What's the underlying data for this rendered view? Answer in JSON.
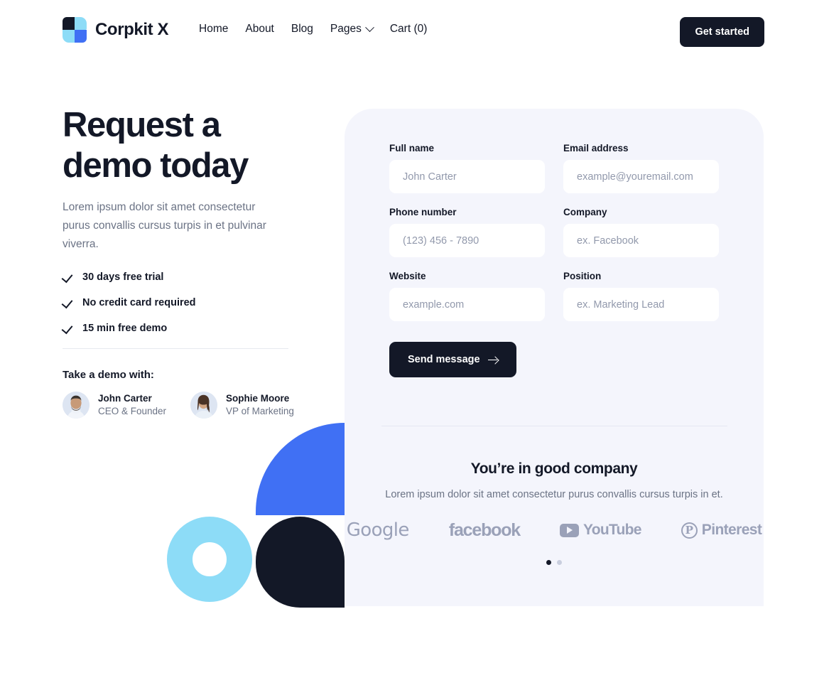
{
  "navbar": {
    "brand_name": "Corpkit X",
    "logo_colors": {
      "dark": "#131827",
      "light_blue": "#8ddcf7",
      "blue": "#4070f4"
    },
    "links": [
      {
        "label": "Home",
        "has_chevron": false
      },
      {
        "label": "About",
        "has_chevron": false
      },
      {
        "label": "Blog",
        "has_chevron": false
      },
      {
        "label": "Pages",
        "has_chevron": true
      },
      {
        "label": "Cart (0)",
        "has_chevron": false
      }
    ],
    "cta_label": "Get started"
  },
  "hero": {
    "title_line1": "Request a",
    "title_line2": "demo today",
    "subtitle": "Lorem ipsum dolor sit amet consectetur purus convallis cursus turpis in et pulvinar viverra.",
    "features": [
      {
        "label": "30 days free trial"
      },
      {
        "label": "No credit card required"
      },
      {
        "label": "15 min free demo"
      }
    ],
    "demo_with_title": "Take a demo with:",
    "people": [
      {
        "name": "John Carter",
        "role": "CEO & Founder"
      },
      {
        "name": "Sophie Moore",
        "role": "VP of Marketing"
      }
    ]
  },
  "form": {
    "fields": [
      {
        "label": "Full name",
        "placeholder": "John Carter",
        "value": ""
      },
      {
        "label": "Email address",
        "placeholder": "example@youremail.com",
        "value": ""
      },
      {
        "label": "Phone number",
        "placeholder": "(123) 456 - 7890",
        "value": ""
      },
      {
        "label": "Company",
        "placeholder": "ex. Facebook",
        "value": ""
      },
      {
        "label": "Website",
        "placeholder": "example.com",
        "value": ""
      },
      {
        "label": "Position",
        "placeholder": "ex. Marketing Lead",
        "value": ""
      }
    ],
    "submit_label": "Send message"
  },
  "company": {
    "title": "You’re in good company",
    "subtitle": "Lorem ipsum dolor sit amet consectetur purus convallis cursus turpis in et.",
    "brands": [
      {
        "name": "Google"
      },
      {
        "name": "facebook"
      },
      {
        "name": "YouTube"
      },
      {
        "name": "Pinterest"
      }
    ],
    "slider_dots": [
      {
        "active": true
      },
      {
        "active": false
      }
    ]
  },
  "theme": {
    "panel_bg": "#f4f5fc",
    "dark": "#131827",
    "blue": "#4070f4",
    "cyan": "#8ddcf7",
    "muted_text": "#6b7385",
    "brand_gray": "#9aa1b8"
  }
}
